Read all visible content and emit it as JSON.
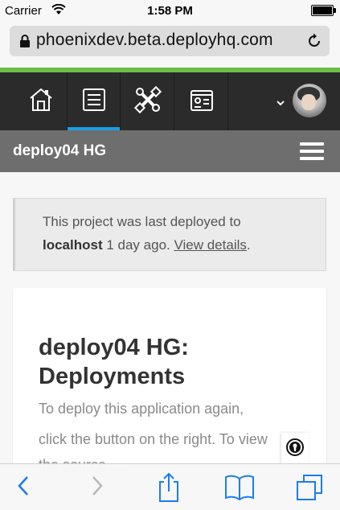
{
  "status_bar": {
    "carrier": "Carrier",
    "time": "1:58 PM"
  },
  "browser": {
    "url": "phoenixdev.beta.deployhq.com"
  },
  "nav": {
    "items": [
      {
        "icon": "house-icon"
      },
      {
        "icon": "server-icon",
        "active": true
      },
      {
        "icon": "tools-icon"
      },
      {
        "icon": "id-card-icon"
      }
    ],
    "accent": "#1a9ee2"
  },
  "project": {
    "name": "deploy04 HG"
  },
  "notice": {
    "text_1": "This project was last deployed to",
    "server": "localhost",
    "text_2": " 1 day ago. ",
    "link": "View details",
    "text_3": "."
  },
  "content": {
    "heading": "deploy04 HG: Deployments",
    "para_line1": "To deploy this application again,",
    "para_line2": "click the button on the right. To view",
    "para_line3": "the source ... "
  },
  "colors": {
    "brand_green": "#6bbd45",
    "nav_bg": "#2b2b2b",
    "header_bg": "#6e6e6e",
    "ios_blue": "#1a7cf5"
  }
}
